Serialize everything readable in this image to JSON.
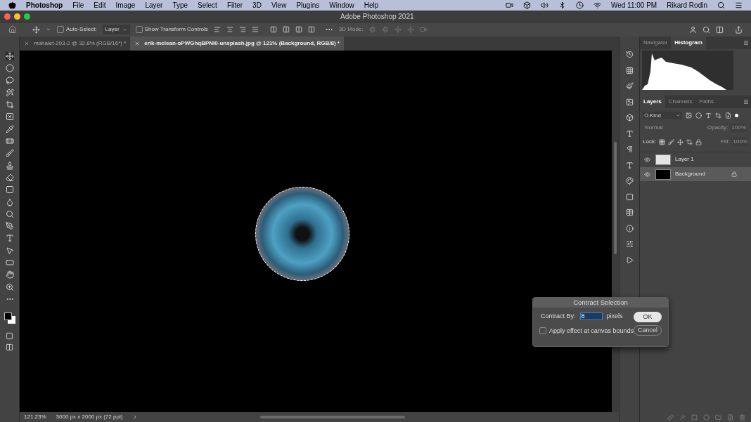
{
  "menu_bar": {
    "app": "Photoshop",
    "items": [
      "File",
      "Edit",
      "Image",
      "Layer",
      "Type",
      "Select",
      "Filter",
      "3D",
      "View",
      "Plugins",
      "Window",
      "Help"
    ],
    "clock": "Wed 11:00 PM",
    "user": "Rikard Rodin"
  },
  "window": {
    "title": "Adobe Photoshop 2021"
  },
  "options_bar": {
    "auto_select": {
      "label": "Auto-Select:",
      "checked": false
    },
    "target": "Layer",
    "transform_controls": {
      "label": "Show Transform Controls",
      "checked": false
    },
    "mode_3d": "3D Mode:"
  },
  "tabs": [
    {
      "label": "mahalet-293-2 @ 32.8% (RGB/16*) *",
      "selected": false
    },
    {
      "label": "erik-mclean-oPWGhqBPNI0-unsplash.jpg @ 121% (Background, RGB/8) *",
      "selected": true
    }
  ],
  "top_panel": {
    "tabs": [
      {
        "label": "Navigator",
        "selected": false
      },
      {
        "label": "Histogram",
        "selected": true
      }
    ]
  },
  "layers_panel": {
    "tabs": [
      {
        "label": "Layers",
        "selected": true
      },
      {
        "label": "Channels",
        "selected": false
      },
      {
        "label": "Paths",
        "selected": false
      }
    ],
    "filter": "Kind",
    "blend_mode": "Normal",
    "opacity_label": "Opacity:",
    "opacity": "100%",
    "lock_label": "Lock:",
    "fill_label": "Fill:",
    "fill": "100%",
    "layers": [
      {
        "name": "Layer 1",
        "kind": "transparent",
        "visible": true,
        "locked": false,
        "selected": false
      },
      {
        "name": "Background",
        "kind": "solid",
        "visible": true,
        "locked": true,
        "selected": true
      }
    ]
  },
  "dialog": {
    "title": "Contract Selection",
    "label": "Contract By:",
    "value": "8",
    "unit": "pixels",
    "apply_bounds": {
      "label": "Apply effect at canvas bounds",
      "checked": false
    },
    "buttons": [
      "OK",
      "Cancel"
    ]
  },
  "status_bar": {
    "zoom": "121.23%",
    "doc_size": "3000 px x 2000 px (72 ppi)"
  }
}
